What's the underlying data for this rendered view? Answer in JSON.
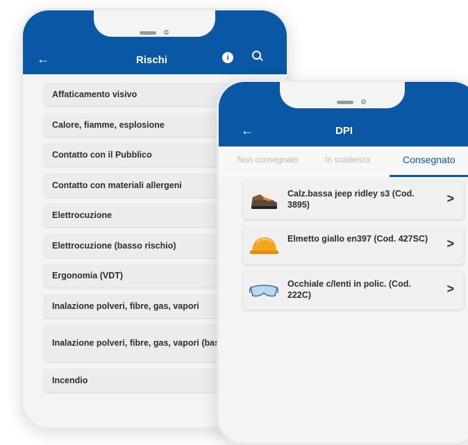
{
  "rischi_screen": {
    "title": "Rischi",
    "back_icon": "arrow-left",
    "info_icon": "info",
    "search_icon": "search",
    "items": [
      "Affaticamento visivo",
      "Calore, fiamme, esplosione",
      "Contatto con il Pubblico",
      "Contatto con materiali allergeni",
      "Elettrocuzione",
      "Elettrocuzione (basso rischio)",
      "Ergonomia (VDT)",
      "Inalazione polveri, fibre, gas, vapori",
      "Inalazione polveri, fibre, gas, vapori (basso)",
      "Incendio"
    ]
  },
  "dpi_screen": {
    "title": "DPI",
    "back_icon": "arrow-left",
    "tabs": [
      "Non consegnato",
      "In scadenza",
      "Consegnato"
    ],
    "active_tab": "Consegnato",
    "items": [
      {
        "label": "Calz.bassa jeep ridley s3 (Cod. 3895)",
        "icon": "safety-shoe"
      },
      {
        "label": "Elmetto giallo en397 (Cod. 427SC)",
        "icon": "hard-hat"
      },
      {
        "label": "Occhiale c/lenti in polic. (Cod. 222C)",
        "icon": "safety-glasses"
      }
    ]
  },
  "colors": {
    "header": "#0a57a6",
    "background": "#f4f4f4",
    "active_tab": "#0a57a6"
  }
}
